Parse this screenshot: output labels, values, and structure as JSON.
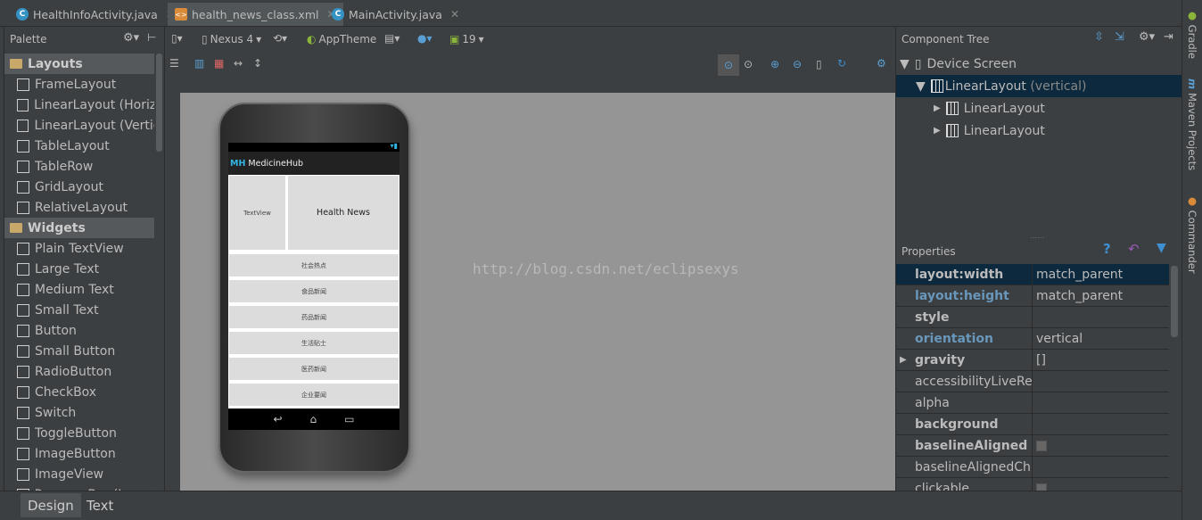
{
  "tabs": [
    {
      "label": "HealthInfoActivity.java",
      "icon": "java-class-icon",
      "active": false
    },
    {
      "label": "health_news_class.xml",
      "icon": "xml-icon",
      "active": true
    },
    {
      "label": "MainActivity.java",
      "icon": "java-class-icon",
      "active": false
    }
  ],
  "palette": {
    "title": "Palette",
    "sections": [
      {
        "label": "Layouts",
        "items": [
          "FrameLayout",
          "LinearLayout (Horizo",
          "LinearLayout (Vertic",
          "TableLayout",
          "TableRow",
          "GridLayout",
          "RelativeLayout"
        ]
      },
      {
        "label": "Widgets",
        "items": [
          "Plain TextView",
          "Large Text",
          "Medium Text",
          "Small Text",
          "Button",
          "Small Button",
          "RadioButton",
          "CheckBox",
          "Switch",
          "ToggleButton",
          "ImageButton",
          "ImageView",
          "ProgressBar (Large)"
        ]
      }
    ]
  },
  "toolbar": {
    "device": "Nexus 4",
    "theme": "AppTheme",
    "api": "19"
  },
  "phone": {
    "app_icon": "MH",
    "app_title": "MedicineHub",
    "textview": "TextView",
    "header": "Health News",
    "buttons": [
      "社会热点",
      "食品新闻",
      "药品新闻",
      "生活贴士",
      "医药新闻",
      "企业要闻"
    ]
  },
  "watermark": "http://blog.csdn.net/eclipsexys",
  "component_tree": {
    "title": "Component Tree",
    "items": [
      {
        "label": "Device Screen"
      },
      {
        "label": "LinearLayout",
        "suffix": " (vertical)"
      },
      {
        "label": "LinearLayout"
      },
      {
        "label": "LinearLayout"
      }
    ]
  },
  "properties": {
    "title": "Properties",
    "rows": [
      {
        "name": "layout:width",
        "value": "match_parent"
      },
      {
        "name": "layout:height",
        "value": "match_parent"
      },
      {
        "name": "style",
        "value": ""
      },
      {
        "name": "orientation",
        "value": "vertical"
      },
      {
        "name": "gravity",
        "value": "[]"
      },
      {
        "name": "accessibilityLiveReg",
        "value": ""
      },
      {
        "name": "alpha",
        "value": ""
      },
      {
        "name": "background",
        "value": ""
      },
      {
        "name": "baselineAligned",
        "value": ""
      },
      {
        "name": "baselineAlignedChi",
        "value": ""
      },
      {
        "name": "clickable",
        "value": ""
      }
    ]
  },
  "side_tools": [
    "Gradle",
    "Maven Projects",
    "Commander"
  ],
  "bottom_tabs": [
    "Design",
    "Text"
  ],
  "colors": {
    "accent": "#33b5e5",
    "selection": "#0d293e",
    "canvas": "#959595"
  }
}
